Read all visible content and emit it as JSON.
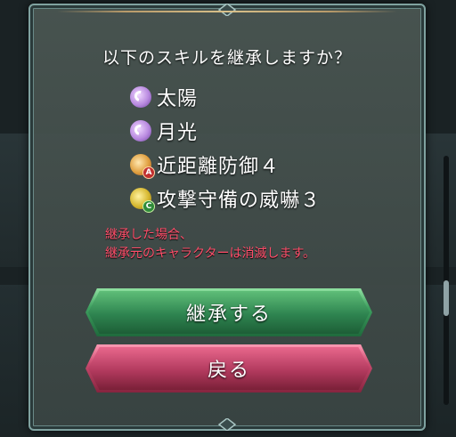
{
  "dialog": {
    "question": "以下のスキルを継承しますか？",
    "skills": [
      {
        "name": "太陽",
        "icon": "special-skill-icon"
      },
      {
        "name": "月光",
        "icon": "special-skill-icon"
      },
      {
        "name": "近距離防御４",
        "icon": "a-skill-icon",
        "slot": "A"
      },
      {
        "name": "攻撃守備の威嚇３",
        "icon": "c-skill-icon",
        "slot": "C"
      }
    ],
    "warning_line1": "継承した場合、",
    "warning_line2": "継承元のキャラクターは消滅します。",
    "confirm_label": "継承する",
    "back_label": "戻る"
  },
  "colors": {
    "confirm_button": "#3ea060",
    "back_button": "#c84a6e",
    "warning_text": "#ff4e6a"
  }
}
